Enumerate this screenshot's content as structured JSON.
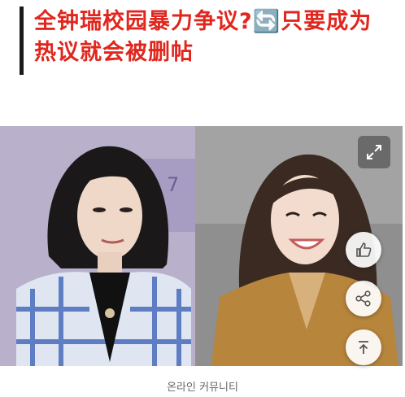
{
  "article": {
    "title": "全钟瑞校园暴力争议?🔄只要成为热议就会被删帖"
  },
  "image": {
    "caption": "온라인 커뮤니티"
  },
  "actions": {
    "expand_icon": "expand-icon",
    "like_icon": "thumbs-up-icon",
    "share_icon": "share-icon",
    "top_icon": "back-to-top-icon"
  },
  "colors": {
    "title": "#e0261d",
    "accent_bar": "#1a1a1a",
    "left_bg": "#b8aecb",
    "right_bg": "#9a9a9a"
  }
}
